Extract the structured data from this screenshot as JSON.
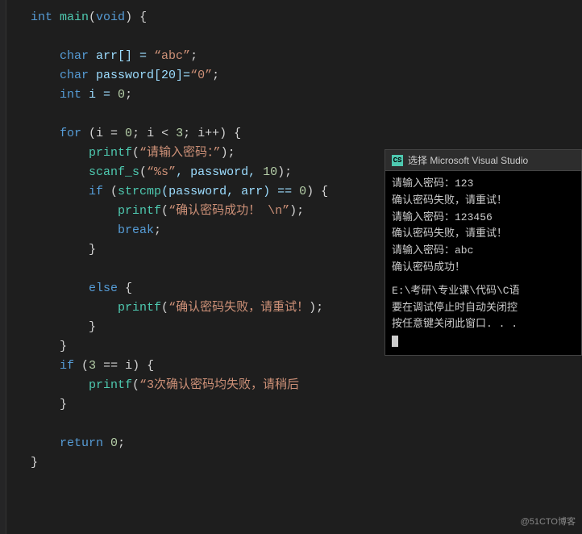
{
  "editor": {
    "lines": [
      {
        "num": "",
        "tokens": [
          {
            "text": "int ",
            "class": "kw"
          },
          {
            "text": "main",
            "class": "fn"
          },
          {
            "text": "(",
            "class": "punct"
          },
          {
            "text": "void",
            "class": "kw"
          },
          {
            "text": ") {",
            "class": "punct"
          }
        ]
      },
      {
        "num": "",
        "tokens": []
      },
      {
        "num": "",
        "tokens": [
          {
            "text": "    ",
            "class": ""
          },
          {
            "text": "char",
            "class": "kw"
          },
          {
            "text": " arr[] = ",
            "class": "var"
          },
          {
            "text": "“abc”",
            "class": "str"
          },
          {
            "text": ";",
            "class": "punct"
          }
        ]
      },
      {
        "num": "",
        "tokens": [
          {
            "text": "    ",
            "class": ""
          },
          {
            "text": "char",
            "class": "kw"
          },
          {
            "text": " password[20]=",
            "class": "var"
          },
          {
            "text": "“0”",
            "class": "str"
          },
          {
            "text": ";",
            "class": "punct"
          }
        ]
      },
      {
        "num": "",
        "tokens": [
          {
            "text": "    ",
            "class": ""
          },
          {
            "text": "int",
            "class": "kw"
          },
          {
            "text": " i = ",
            "class": "var"
          },
          {
            "text": "0",
            "class": "num"
          },
          {
            "text": ";",
            "class": "punct"
          }
        ]
      },
      {
        "num": "",
        "tokens": []
      },
      {
        "num": "",
        "tokens": [
          {
            "text": "    ",
            "class": ""
          },
          {
            "text": "for",
            "class": "kw"
          },
          {
            "text": " (i = ",
            "class": "punct"
          },
          {
            "text": "0",
            "class": "num"
          },
          {
            "text": "; i < ",
            "class": "punct"
          },
          {
            "text": "3",
            "class": "num"
          },
          {
            "text": "; i++) {",
            "class": "punct"
          }
        ]
      },
      {
        "num": "",
        "tokens": [
          {
            "text": "        ",
            "class": ""
          },
          {
            "text": "printf",
            "class": "fn"
          },
          {
            "text": "(",
            "class": "punct"
          },
          {
            "text": "“请输入密码：”",
            "class": "str"
          },
          {
            "text": ");",
            "class": "punct"
          }
        ]
      },
      {
        "num": "",
        "tokens": [
          {
            "text": "        ",
            "class": ""
          },
          {
            "text": "scanf_s",
            "class": "fn"
          },
          {
            "text": "(",
            "class": "punct"
          },
          {
            "text": "“%s”",
            "class": "str"
          },
          {
            "text": ", password, ",
            "class": "var"
          },
          {
            "text": "10",
            "class": "num"
          },
          {
            "text": ");",
            "class": "punct"
          }
        ]
      },
      {
        "num": "",
        "tokens": [
          {
            "text": "        ",
            "class": ""
          },
          {
            "text": "if",
            "class": "kw"
          },
          {
            "text": " (",
            "class": "punct"
          },
          {
            "text": "strcmp",
            "class": "fn"
          },
          {
            "text": "(password, arr) == ",
            "class": "var"
          },
          {
            "text": "0",
            "class": "num"
          },
          {
            "text": ") {",
            "class": "punct"
          }
        ]
      },
      {
        "num": "",
        "tokens": [
          {
            "text": "            ",
            "class": ""
          },
          {
            "text": "printf",
            "class": "fn"
          },
          {
            "text": "(",
            "class": "punct"
          },
          {
            "text": "“确认密码成功！ \\n”",
            "class": "str"
          },
          {
            "text": ");",
            "class": "punct"
          }
        ]
      },
      {
        "num": "",
        "tokens": [
          {
            "text": "            ",
            "class": ""
          },
          {
            "text": "break",
            "class": "kw"
          },
          {
            "text": ";",
            "class": "punct"
          }
        ]
      },
      {
        "num": "",
        "tokens": [
          {
            "text": "        }",
            "class": "punct"
          }
        ]
      },
      {
        "num": "",
        "tokens": []
      },
      {
        "num": "",
        "tokens": [
          {
            "text": "        ",
            "class": ""
          },
          {
            "text": "else",
            "class": "kw"
          },
          {
            "text": " {",
            "class": "punct"
          }
        ]
      },
      {
        "num": "",
        "tokens": [
          {
            "text": "            ",
            "class": ""
          },
          {
            "text": "printf",
            "class": "fn"
          },
          {
            "text": "(",
            "class": "punct"
          },
          {
            "text": "“确认密码失败，请重试！",
            "class": "str"
          },
          {
            "text": ")",
            "class": "punct"
          },
          {
            "text": ";",
            "class": "punct"
          }
        ]
      },
      {
        "num": "",
        "tokens": [
          {
            "text": "        }",
            "class": "punct"
          }
        ]
      },
      {
        "num": "",
        "tokens": [
          {
            "text": "    }",
            "class": "punct"
          }
        ]
      },
      {
        "num": "",
        "tokens": [
          {
            "text": "    ",
            "class": ""
          },
          {
            "text": "if",
            "class": "kw"
          },
          {
            "text": " (",
            "class": "punct"
          },
          {
            "text": "3",
            "class": "num"
          },
          {
            "text": " == i) {",
            "class": "punct"
          }
        ]
      },
      {
        "num": "",
        "tokens": [
          {
            "text": "        ",
            "class": ""
          },
          {
            "text": "printf",
            "class": "fn"
          },
          {
            "text": "(",
            "class": "punct"
          },
          {
            "text": "“3次确认密码均失败，请稍后",
            "class": "str"
          }
        ]
      },
      {
        "num": "",
        "tokens": [
          {
            "text": "    }",
            "class": "punct"
          }
        ]
      },
      {
        "num": "",
        "tokens": []
      },
      {
        "num": "",
        "tokens": [
          {
            "text": "    ",
            "class": ""
          },
          {
            "text": "return",
            "class": "kw"
          },
          {
            "text": " ",
            "class": ""
          },
          {
            "text": "0",
            "class": "num"
          },
          {
            "text": ";",
            "class": "punct"
          }
        ]
      },
      {
        "num": "",
        "tokens": [
          {
            "text": "}",
            "class": "punct"
          }
        ]
      }
    ]
  },
  "console": {
    "title": "选择 Microsoft Visual Studio",
    "icon_label": "CS",
    "lines": [
      "请输入密码：123",
      "确认密码失败，请重试！",
      "请输入密码：123456",
      "确认密码失败，请重试！",
      "请输入密码：abc",
      "确认密码成功！"
    ],
    "path_line": "E:\\考研\\专业课\\代码\\C语",
    "note_line": "要在调试停止时自动关闭控",
    "note_line2": "按任意键关闭此窗口. . ."
  },
  "watermark": "@51CTO博客"
}
